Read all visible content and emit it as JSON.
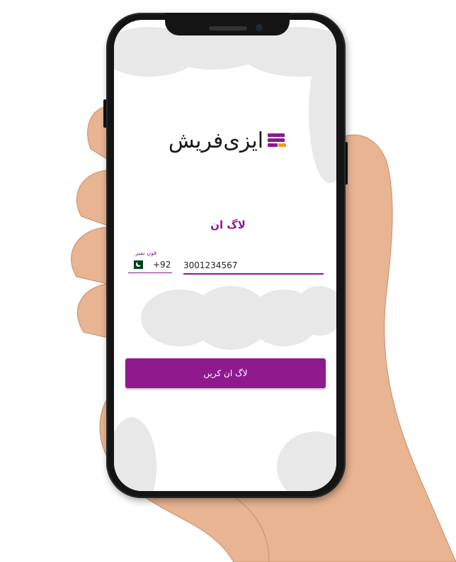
{
  "app": {
    "logo_text": "ایزی‌فریش",
    "logo_icon": "stacked-bars-logo-icon"
  },
  "login": {
    "title": "لاگ ان",
    "phone_label": "فون نمبر",
    "country_flag": "pakistan-flag-icon",
    "country_code": "+92",
    "phone_value": "3001234567",
    "button_label": "لاگ ان کریں"
  },
  "colors": {
    "accent": "#8f1a8e",
    "logo_orange": "#f39a1c",
    "cloud": "#e8e8e8"
  }
}
